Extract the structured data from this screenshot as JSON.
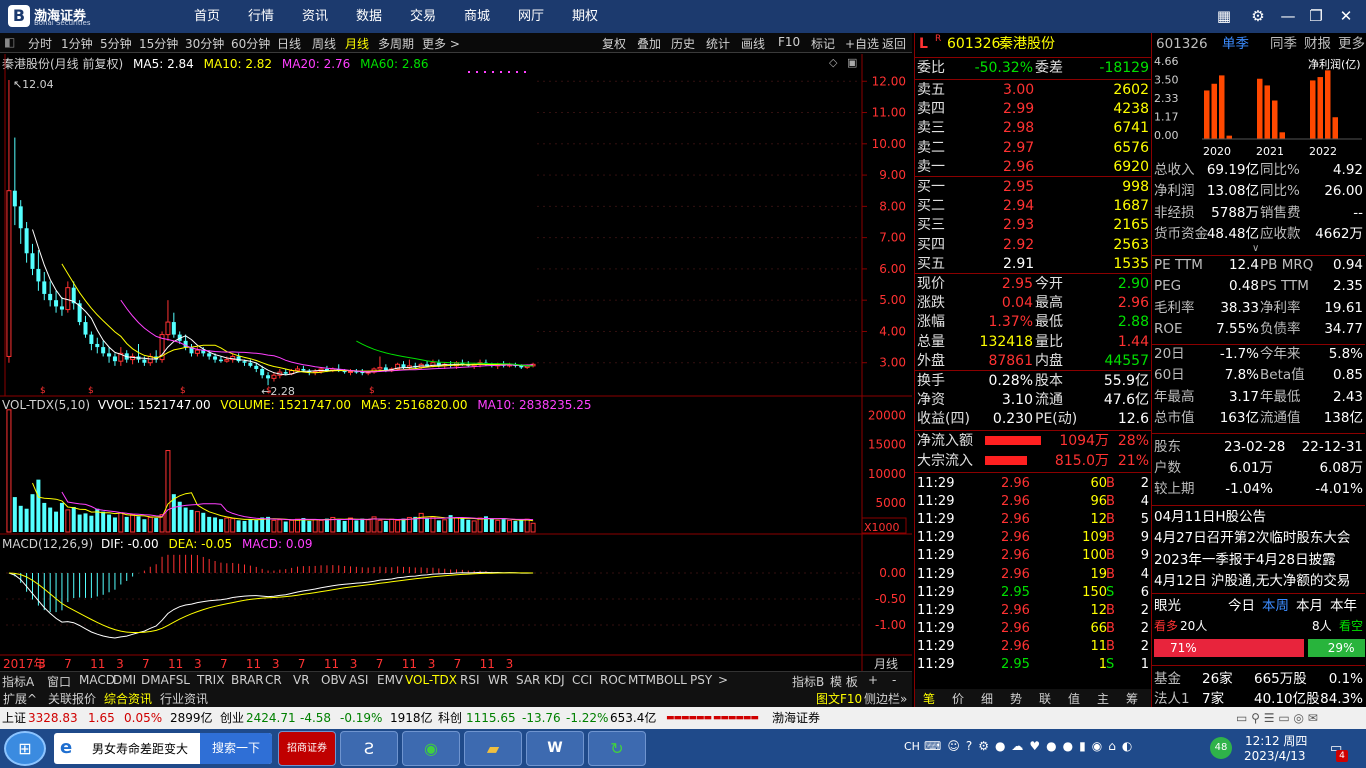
{
  "app": {
    "logo_text": "渤海证券",
    "logo_sub": "Bohai Securities"
  },
  "menu": [
    "首页",
    "行情",
    "资讯",
    "数据",
    "交易",
    "商城",
    "网厅",
    "期权"
  ],
  "toolbar": {
    "left": [
      "分时",
      "1分钟",
      "5分钟",
      "15分钟",
      "30分钟",
      "60分钟",
      "日线",
      "周线",
      "月线",
      "多周期",
      "更多 >"
    ],
    "active": "月线",
    "right": [
      "复权",
      "叠加",
      "历史",
      "统计",
      "画线",
      "F10",
      "标记",
      "+自选",
      "返回"
    ]
  },
  "chart_header": {
    "name": "秦港股份(月线 前复权)",
    "ma5": "MA5: 2.84",
    "ma10": "MA10: 2.82",
    "ma20": "MA20: 2.76",
    "ma60": "MA60: 2.86",
    "high_label": "12.04",
    "low_label": "2.28",
    "yticks": [
      "12.00",
      "11.00",
      "10.00",
      "9.00",
      "8.00",
      "7.00",
      "6.00",
      "5.00",
      "4.00",
      "3.00"
    ]
  },
  "volume_header": {
    "name": "VOL-TDX(5,10)",
    "vvol": "VVOL: 1521747.00",
    "volume": "VOLUME: 1521747.00",
    "ma5": "MA5: 2516820.00",
    "ma10": "MA10: 2838235.25",
    "yticks": [
      "20000",
      "15000",
      "10000",
      "5000"
    ],
    "unit": "X1000"
  },
  "macd_header": {
    "name": "MACD(12,26,9)",
    "dif": "DIF: -0.00",
    "dea": "DEA: -0.05",
    "macd": "MACD: 0.09",
    "yticks": [
      "0.00",
      "-0.50",
      "-1.00"
    ]
  },
  "xaxis": {
    "labels": [
      "2017年",
      "3",
      "7",
      "11",
      "3",
      "7",
      "11",
      "3",
      "7",
      "11",
      "3",
      "7",
      "11",
      "3",
      "7",
      "11",
      "3",
      "7",
      "11",
      "3"
    ],
    "period": "月线"
  },
  "chart_data": {
    "type": "candlestick",
    "candles": [
      [
        3.2,
        12.04,
        3.0,
        8.5
      ],
      [
        8.5,
        10.2,
        7.4,
        8.0
      ],
      [
        8.0,
        8.2,
        6.8,
        7.3
      ],
      [
        7.3,
        7.5,
        6.2,
        6.5
      ],
      [
        6.5,
        6.8,
        5.8,
        6.0
      ],
      [
        6.0,
        6.6,
        5.3,
        5.6
      ],
      [
        5.6,
        5.9,
        5.0,
        5.2
      ],
      [
        5.2,
        5.6,
        4.8,
        5.0
      ],
      [
        5.0,
        5.3,
        4.6,
        4.8
      ],
      [
        4.8,
        5.1,
        4.5,
        4.7
      ],
      [
        4.7,
        5.6,
        4.6,
        5.4
      ],
      [
        5.4,
        5.6,
        4.7,
        4.9
      ],
      [
        4.9,
        5.0,
        4.2,
        4.3
      ],
      [
        4.3,
        4.5,
        3.8,
        3.9
      ],
      [
        3.9,
        4.0,
        3.4,
        3.6
      ],
      [
        3.6,
        3.8,
        3.3,
        3.5
      ],
      [
        3.5,
        3.7,
        3.2,
        3.3
      ],
      [
        3.3,
        3.5,
        3.0,
        3.2
      ],
      [
        3.2,
        3.3,
        2.9,
        3.05
      ],
      [
        3.05,
        3.5,
        2.9,
        3.3
      ],
      [
        3.3,
        3.4,
        3.0,
        3.1
      ],
      [
        3.1,
        3.3,
        2.95,
        3.2
      ],
      [
        3.2,
        3.6,
        3.0,
        3.1
      ],
      [
        3.1,
        3.2,
        2.9,
        3.0
      ],
      [
        3.0,
        3.3,
        2.9,
        3.2
      ],
      [
        3.2,
        3.4,
        3.0,
        3.1
      ],
      [
        3.1,
        4.0,
        3.0,
        3.9
      ],
      [
        3.9,
        5.0,
        3.7,
        4.3
      ],
      [
        4.3,
        4.6,
        3.8,
        3.9
      ],
      [
        3.9,
        4.0,
        3.6,
        3.7
      ],
      [
        3.7,
        3.9,
        3.4,
        3.5
      ],
      [
        3.5,
        3.6,
        3.2,
        3.3
      ],
      [
        3.3,
        3.5,
        3.2,
        3.4
      ],
      [
        3.4,
        3.5,
        3.2,
        3.3
      ],
      [
        3.3,
        3.4,
        3.1,
        3.2
      ],
      [
        3.2,
        3.3,
        3.0,
        3.1
      ],
      [
        3.1,
        3.2,
        3.0,
        3.05
      ],
      [
        3.05,
        3.2,
        3.0,
        3.1
      ],
      [
        3.1,
        3.3,
        3.0,
        3.2
      ],
      [
        3.2,
        3.3,
        3.0,
        3.05
      ],
      [
        3.05,
        3.1,
        2.9,
        3.0
      ],
      [
        3.0,
        3.1,
        2.85,
        2.9
      ],
      [
        2.9,
        3.0,
        2.7,
        2.8
      ],
      [
        2.8,
        2.9,
        2.5,
        2.6
      ],
      [
        2.6,
        2.7,
        2.28,
        2.5
      ],
      [
        2.5,
        2.7,
        2.4,
        2.6
      ],
      [
        2.6,
        2.8,
        2.5,
        2.7
      ],
      [
        2.7,
        2.8,
        2.6,
        2.65
      ],
      [
        2.65,
        2.8,
        2.6,
        2.75
      ],
      [
        2.75,
        2.9,
        2.7,
        2.8
      ],
      [
        2.8,
        2.9,
        2.7,
        2.75
      ],
      [
        2.75,
        2.8,
        2.6,
        2.7
      ],
      [
        2.7,
        2.8,
        2.6,
        2.72
      ],
      [
        2.72,
        2.85,
        2.65,
        2.8
      ],
      [
        2.8,
        2.9,
        2.7,
        2.75
      ],
      [
        2.75,
        2.85,
        2.7,
        2.8
      ],
      [
        2.8,
        2.95,
        2.7,
        2.75
      ],
      [
        2.75,
        2.8,
        2.65,
        2.7
      ],
      [
        2.7,
        2.8,
        2.6,
        2.72
      ],
      [
        2.72,
        2.8,
        2.65,
        2.7
      ],
      [
        2.7,
        2.8,
        2.6,
        2.68
      ],
      [
        2.68,
        2.75,
        2.6,
        2.7
      ],
      [
        2.7,
        2.85,
        2.65,
        2.8
      ],
      [
        2.8,
        3.2,
        2.75,
        2.85
      ],
      [
        2.85,
        2.95,
        2.7,
        2.75
      ],
      [
        2.75,
        2.85,
        2.7,
        2.8
      ],
      [
        2.8,
        3.0,
        2.75,
        2.95
      ],
      [
        2.95,
        3.05,
        2.8,
        2.85
      ],
      [
        2.85,
        3.1,
        2.8,
        2.9
      ],
      [
        2.9,
        3.0,
        2.8,
        2.85
      ],
      [
        2.85,
        3.0,
        2.8,
        2.95
      ],
      [
        2.95,
        3.05,
        2.85,
        2.9
      ],
      [
        2.9,
        3.1,
        2.85,
        3.0
      ],
      [
        3.0,
        3.1,
        2.85,
        2.9
      ],
      [
        2.9,
        3.0,
        2.8,
        2.95
      ],
      [
        2.95,
        3.05,
        2.85,
        2.9
      ],
      [
        2.9,
        3.05,
        2.8,
        3.0
      ],
      [
        3.0,
        3.1,
        2.9,
        2.95
      ],
      [
        2.95,
        3.05,
        2.85,
        2.9
      ],
      [
        2.9,
        3.0,
        2.8,
        2.95
      ],
      [
        2.95,
        3.1,
        2.85,
        3.0
      ],
      [
        3.0,
        3.1,
        2.9,
        2.95
      ],
      [
        2.95,
        3.0,
        2.85,
        2.9
      ],
      [
        2.9,
        3.0,
        2.8,
        2.95
      ],
      [
        2.95,
        3.05,
        2.85,
        2.9
      ],
      [
        2.9,
        3.0,
        2.85,
        2.95
      ],
      [
        2.95,
        3.0,
        2.85,
        2.9
      ],
      [
        2.9,
        2.95,
        2.8,
        2.85
      ],
      [
        2.85,
        2.95,
        2.8,
        2.9
      ],
      [
        2.9,
        3.0,
        2.85,
        2.95
      ]
    ],
    "volumes": [
      21000,
      6000,
      4500,
      4000,
      6500,
      9000,
      5000,
      4200,
      3500,
      5000,
      3800,
      4300,
      3000,
      3200,
      2800,
      4000,
      3500,
      3000,
      2500,
      3300,
      2600,
      3000,
      2700,
      2200,
      2500,
      2400,
      3000,
      14000,
      6500,
      5200,
      4200,
      3800,
      3500,
      3300,
      2600,
      2500,
      2200,
      2400,
      2300,
      2000,
      1900,
      2200,
      2100,
      2500,
      2600,
      2000,
      2100,
      1800,
      2000,
      2200,
      2400,
      1900,
      2100,
      2000,
      2300,
      2500,
      2200,
      1900,
      2400,
      2000,
      2300,
      2100,
      2600,
      2000,
      1900,
      2200,
      2000,
      2300,
      2500,
      2600,
      3200,
      2400,
      2600,
      2000,
      2100,
      2900,
      2400,
      2300,
      2100,
      1900,
      2400,
      2700,
      2300,
      2000,
      2200,
      2000,
      1900,
      2100,
      2200,
      1500
    ]
  },
  "indicator_tabs": [
    "指标A",
    "窗口",
    "MACD",
    "DMI",
    "DMA",
    "FSL",
    "TRIX",
    "BRAR",
    "CR",
    "VR",
    "OBV",
    "ASI",
    "EMV",
    "VOL-TDX",
    "RSI",
    "WR",
    "SAR",
    "KDJ",
    "CCI",
    "ROC",
    "MTM",
    "BOLL",
    "PSY",
    ">"
  ],
  "indicator_right": [
    "指标B",
    "模 板",
    "+",
    "-"
  ],
  "bottom_nav": [
    "扩展^",
    "关联报价",
    "综合资讯",
    "行业资讯"
  ],
  "bottom_right": [
    "图文F10",
    "侧边栏»"
  ],
  "quote": {
    "flag_l": "L",
    "flag_r": "R",
    "code": "601326",
    "name": "秦港股份",
    "weibi_label": "委比",
    "weibi": "-50.32%",
    "weicha_label": "委差",
    "weicha": "-18129",
    "asks": [
      {
        "l": "卖五",
        "p": "3.00",
        "v": "2602"
      },
      {
        "l": "卖四",
        "p": "2.99",
        "v": "4238"
      },
      {
        "l": "卖三",
        "p": "2.98",
        "v": "6741"
      },
      {
        "l": "卖二",
        "p": "2.97",
        "v": "6576"
      },
      {
        "l": "卖一",
        "p": "2.96",
        "v": "6920"
      }
    ],
    "bids": [
      {
        "l": "买一",
        "p": "2.95",
        "v": "998"
      },
      {
        "l": "买二",
        "p": "2.94",
        "v": "1687"
      },
      {
        "l": "买三",
        "p": "2.93",
        "v": "2165"
      },
      {
        "l": "买四",
        "p": "2.92",
        "v": "2563"
      },
      {
        "l": "买五",
        "p": "2.91",
        "v": "1535"
      }
    ],
    "stats": [
      {
        "l1": "现价",
        "v1": "2.95",
        "c1": "red",
        "l2": "今开",
        "v2": "2.90",
        "c2": "grn"
      },
      {
        "l1": "涨跌",
        "v1": "0.04",
        "c1": "red",
        "l2": "最高",
        "v2": "2.96",
        "c2": "red"
      },
      {
        "l1": "涨幅",
        "v1": "1.37%",
        "c1": "red",
        "l2": "最低",
        "v2": "2.88",
        "c2": "grn"
      },
      {
        "l1": "总量",
        "v1": "132418",
        "c1": "yel",
        "l2": "量比",
        "v2": "1.44",
        "c2": "red"
      },
      {
        "l1": "外盘",
        "v1": "87861",
        "c1": "red",
        "l2": "内盘",
        "v2": "44557",
        "c2": "grn"
      }
    ],
    "stats2": [
      {
        "l1": "换手",
        "v1": "0.28%",
        "l2": "股本",
        "v2": "55.9亿"
      },
      {
        "l1": "净资",
        "v1": "3.10",
        "l2": "流通",
        "v2": "47.6亿"
      },
      {
        "l1": "收益(四)",
        "v1": "0.230",
        "l2": "PE(动)",
        "v2": "12.6"
      }
    ],
    "flows": [
      {
        "l": "净流入额",
        "v": "1094万",
        "p": "28%",
        "bar": 0.28
      },
      {
        "l": "大宗流入",
        "v": "815.0万",
        "p": "21%",
        "bar": 0.21
      }
    ],
    "ticks": [
      {
        "t": "11:29",
        "p": "2.96",
        "v": "60",
        "s": "B",
        "n": "2"
      },
      {
        "t": "11:29",
        "p": "2.96",
        "v": "96",
        "s": "B",
        "n": "4"
      },
      {
        "t": "11:29",
        "p": "2.96",
        "v": "12",
        "s": "B",
        "n": "5"
      },
      {
        "t": "11:29",
        "p": "2.96",
        "v": "109",
        "s": "B",
        "n": "9"
      },
      {
        "t": "11:29",
        "p": "2.96",
        "v": "100",
        "s": "B",
        "n": "9"
      },
      {
        "t": "11:29",
        "p": "2.96",
        "v": "19",
        "s": "B",
        "n": "4"
      },
      {
        "t": "11:29",
        "p": "2.95",
        "v": "150",
        "s": "S",
        "n": "6"
      },
      {
        "t": "11:29",
        "p": "2.96",
        "v": "12",
        "s": "B",
        "n": "2"
      },
      {
        "t": "11:29",
        "p": "2.96",
        "v": "66",
        "s": "B",
        "n": "2"
      },
      {
        "t": "11:29",
        "p": "2.96",
        "v": "11",
        "s": "B",
        "n": "2"
      },
      {
        "t": "11:29",
        "p": "2.95",
        "v": "1",
        "s": "S",
        "n": "1"
      }
    ],
    "bottom_tabs": [
      "笔",
      "价",
      "细",
      "势",
      "联",
      "值",
      "主",
      "筹"
    ]
  },
  "fin": {
    "code": "601326",
    "tabs": [
      "单季",
      "同季",
      "财报",
      "更多.."
    ],
    "profit_label": "净利润(亿)",
    "yticks": [
      "4.66",
      "3.50",
      "2.33",
      "1.17",
      "0.00"
    ],
    "years": [
      "2020",
      "2021",
      "2022"
    ],
    "bars": [
      2.9,
      3.3,
      3.8,
      0.2,
      3.6,
      3.2,
      2.3,
      0.4,
      3.5,
      3.7,
      4.1,
      1.3
    ],
    "rows1": [
      {
        "l": "总收入",
        "v": "69.19亿",
        "l2": "同比%",
        "v2": "4.92"
      },
      {
        "l": "净利润",
        "v": "13.08亿",
        "l2": "同比%",
        "v2": "26.00"
      },
      {
        "l": "非经损",
        "v": "5788万",
        "l2": "销售费",
        "v2": "--"
      },
      {
        "l": "货币资金",
        "v": "48.48亿",
        "l2": "应收款",
        "v2": "4662万"
      }
    ],
    "rows2": [
      {
        "l": "PE TTM",
        "v": "12.4",
        "l2": "PB MRQ",
        "v2": "0.94"
      },
      {
        "l": "PEG",
        "v": "0.48",
        "l2": "PS TTM",
        "v2": "2.35"
      },
      {
        "l": "毛利率",
        "v": "38.33",
        "l2": "净利率",
        "v2": "19.61"
      },
      {
        "l": "ROE",
        "v": "7.55%",
        "l2": "负债率",
        "v2": "34.77"
      }
    ],
    "rows3": [
      {
        "l": "20日",
        "v": "-1.7%",
        "l2": "今年来",
        "v2": "5.8%"
      },
      {
        "l": "60日",
        "v": "7.8%",
        "l2": "Beta值",
        "v2": "0.85"
      },
      {
        "l": "年最高",
        "v": "3.17",
        "l2": "年最低",
        "v2": "2.43"
      },
      {
        "l": "总市值",
        "v": "163亿",
        "l2": "流通值",
        "v2": "138亿"
      }
    ],
    "holders": {
      "label": "股东",
      "d1": "23-02-28",
      "d2": "22-12-31",
      "hs_label": "户数",
      "hs1": "6.01万",
      "hs2": "6.08万",
      "cmp_label": "较上期",
      "c1": "-1.04%",
      "c2": "-4.01%"
    },
    "news": [
      "04月11日H股公告",
      "4月27日召开第2次临时股东大会",
      "2023年一季报于4月28日披露",
      "4月12日 沪股通,无大净额的交易"
    ],
    "view": {
      "label": "眼光",
      "tabs": [
        "今日",
        "本周",
        "本月",
        "本年"
      ],
      "bull": "看多",
      "bull_n": "20人",
      "bear_n": "8人",
      "bear": "看空",
      "bull_pct": "71%",
      "bear_pct": "29%",
      "bull_frac": 0.71
    },
    "funds": [
      {
        "l": "基金",
        "a": "26家",
        "b": "665万股",
        "c": "0.1%"
      },
      {
        "l": "法人1",
        "a": "7家",
        "b": "40.10亿股",
        "c": "84.3%"
      }
    ]
  },
  "statusbar": {
    "sh": "上证",
    "sh_v": "3328.83",
    "sh_c": "1.65",
    "sh_p": "0.05%",
    "sh_a": "2899亿",
    "cy": "创业",
    "cy_v": "2424.71",
    "cy_c": "-4.58",
    "cy_p": "-0.19%",
    "cy_a": "1918亿",
    "kc": "科创",
    "kc_v": "1115.65",
    "kc_c": "-13.76",
    "kc_p": "-1.22%",
    "kc_a": "653.4亿",
    "broker": "渤海证券"
  },
  "taskbar": {
    "search_text": "男女寿命差距变大",
    "search_btn": "搜索一下",
    "app_cms": "招商证券",
    "ime": "CH",
    "time": "12:12 周四",
    "date": "2023/4/13",
    "badge": "48",
    "notif": "4"
  }
}
